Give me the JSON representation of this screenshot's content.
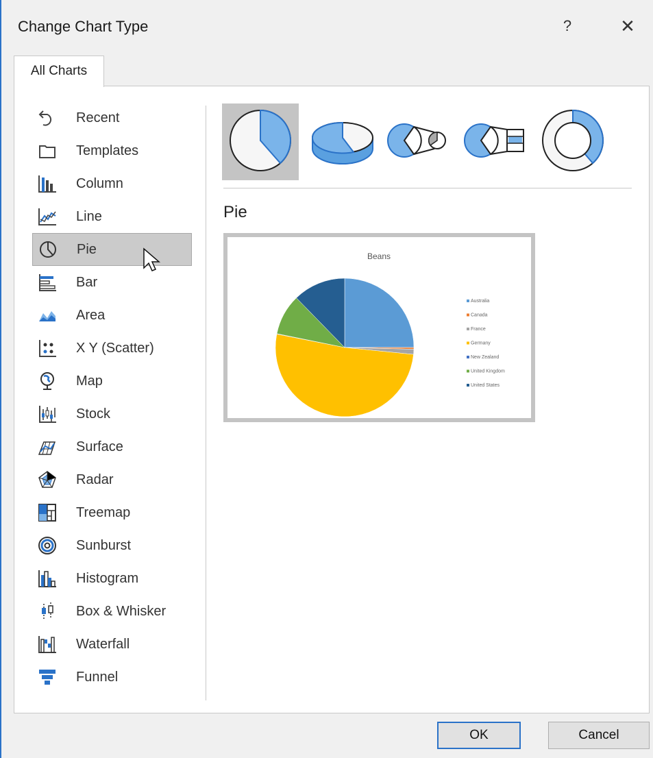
{
  "dialog": {
    "title": "Change Chart Type",
    "help_label": "?",
    "close_label": "✕"
  },
  "tabs": [
    {
      "label": "All Charts"
    }
  ],
  "sidebar": {
    "items": [
      {
        "label": "Recent",
        "icon": "recent-icon"
      },
      {
        "label": "Templates",
        "icon": "templates-icon"
      },
      {
        "label": "Column",
        "icon": "column-chart-icon"
      },
      {
        "label": "Line",
        "icon": "line-chart-icon"
      },
      {
        "label": "Pie",
        "icon": "pie-chart-icon",
        "selected": true
      },
      {
        "label": "Bar",
        "icon": "bar-chart-icon"
      },
      {
        "label": "Area",
        "icon": "area-chart-icon"
      },
      {
        "label": "X Y (Scatter)",
        "icon": "scatter-chart-icon"
      },
      {
        "label": "Map",
        "icon": "map-chart-icon"
      },
      {
        "label": "Stock",
        "icon": "stock-chart-icon"
      },
      {
        "label": "Surface",
        "icon": "surface-chart-icon"
      },
      {
        "label": "Radar",
        "icon": "radar-chart-icon"
      },
      {
        "label": "Treemap",
        "icon": "treemap-chart-icon"
      },
      {
        "label": "Sunburst",
        "icon": "sunburst-chart-icon"
      },
      {
        "label": "Histogram",
        "icon": "histogram-chart-icon"
      },
      {
        "label": "Box & Whisker",
        "icon": "box-whisker-chart-icon"
      },
      {
        "label": "Waterfall",
        "icon": "waterfall-chart-icon"
      },
      {
        "label": "Funnel",
        "icon": "funnel-chart-icon"
      }
    ]
  },
  "subtypes": [
    {
      "icon": "pie-subtype-icon",
      "selected": true
    },
    {
      "icon": "3d-pie-subtype-icon"
    },
    {
      "icon": "pie-of-pie-subtype-icon"
    },
    {
      "icon": "bar-of-pie-subtype-icon"
    },
    {
      "icon": "doughnut-subtype-icon"
    }
  ],
  "section_title": "Pie",
  "chart_data": {
    "type": "pie",
    "title": "Beans",
    "categories": [
      "Australia",
      "Canada",
      "France",
      "Germany",
      "New Zealand",
      "United Kingdom",
      "United States"
    ],
    "values": [
      25,
      0.4,
      1.2,
      51.5,
      0.1,
      9.5,
      12.3
    ],
    "colors": [
      "#5b9bd5",
      "#ed7d31",
      "#a5a5a5",
      "#ffc000",
      "#4472c4",
      "#70ad47",
      "#255e91"
    ],
    "legend": "right"
  },
  "buttons": {
    "ok": "OK",
    "cancel": "Cancel"
  },
  "colors": {
    "accent": "#2a72c8",
    "icon_blue": "#5aa0e0",
    "selected_bg": "#cbcbcb"
  }
}
